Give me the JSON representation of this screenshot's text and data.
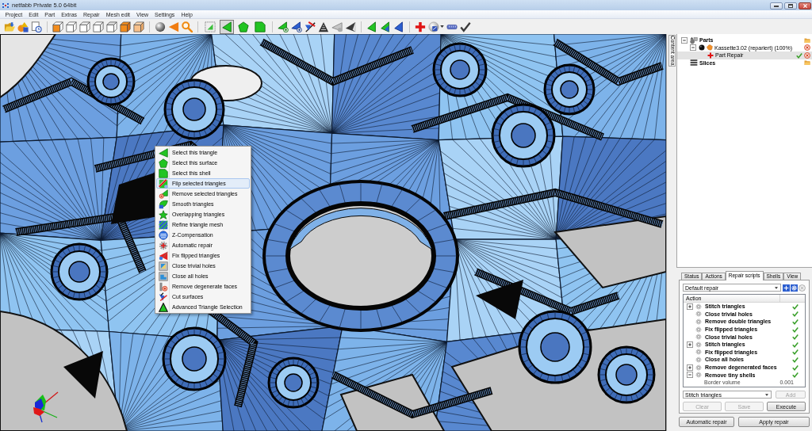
{
  "window": {
    "title": "netfabb Private 5.0 64bit"
  },
  "menu_bar": [
    "Project",
    "Edit",
    "Part",
    "Extras",
    "Repair",
    "Mesh edit",
    "View",
    "Settings",
    "Help"
  ],
  "toolbar": {
    "selection_tools": [
      {
        "selected": false
      },
      {
        "selected": true
      },
      {
        "selected": false
      },
      {
        "selected": false
      }
    ]
  },
  "context_menu": {
    "items": [
      {
        "label": "Select this triangle",
        "selected": false
      },
      {
        "label": "Select this surface",
        "selected": false
      },
      {
        "label": "Select this shell",
        "selected": false
      },
      {
        "label": "Flip selected triangles",
        "selected": true
      },
      {
        "label": "Remove selected triangles",
        "selected": false
      },
      {
        "label": "Smooth triangles",
        "selected": false
      },
      {
        "label": "Overlapping triangles",
        "selected": false
      },
      {
        "label": "Refine triangle mesh",
        "selected": false
      },
      {
        "label": "Z-Compensation",
        "selected": false
      },
      {
        "label": "Automatic repair",
        "selected": false
      },
      {
        "label": "Fix flipped triangles",
        "selected": false
      },
      {
        "label": "Close trivial holes",
        "selected": false
      },
      {
        "label": "Close all holes",
        "selected": false
      },
      {
        "label": "Remove degenerate faces",
        "selected": false
      },
      {
        "label": "Cut surfaces",
        "selected": false
      },
      {
        "label": "Advanced Triangle Selection",
        "selected": false
      }
    ]
  },
  "side_tab": {
    "label": "Content area"
  },
  "project_tree": [
    {
      "label": "Parts",
      "kind": "parts",
      "expanded": true,
      "selected": false,
      "children": [
        {
          "label": "Kassette3.02 (repariert) (100%)",
          "kind": "part",
          "expanded": true,
          "selected": false,
          "children": [
            {
              "label": "Part Repair",
              "kind": "repair",
              "expanded": false,
              "selected": true
            }
          ]
        }
      ]
    },
    {
      "label": "Slices",
      "kind": "slices",
      "expanded": false,
      "selected": false
    }
  ],
  "repair_panel": {
    "tabs": [
      {
        "label": "Status",
        "selected": false
      },
      {
        "label": "Actions",
        "selected": false
      },
      {
        "label": "Repair scripts",
        "selected": true
      },
      {
        "label": "Shells",
        "selected": false
      },
      {
        "label": "View",
        "selected": false
      }
    ],
    "script_select": {
      "value": "Default repair"
    },
    "script_tools": [
      {
        "disabled": false
      },
      {
        "disabled": false
      },
      {
        "disabled": true
      }
    ],
    "table": {
      "columns": [
        "Action"
      ],
      "rows": [
        {
          "label": "Stitch triangles",
          "expandable": true,
          "expanded": false,
          "done": true
        },
        {
          "label": "Close trivial holes",
          "expandable": false,
          "expanded": false,
          "done": true
        },
        {
          "label": "Remove double triangles",
          "expandable": false,
          "expanded": false,
          "done": true
        },
        {
          "label": "Fix flipped triangles",
          "expandable": false,
          "expanded": false,
          "done": true
        },
        {
          "label": "Close trivial holes",
          "expandable": false,
          "expanded": false,
          "done": true
        },
        {
          "label": "Stitch triangles",
          "expandable": true,
          "expanded": false,
          "done": true
        },
        {
          "label": "Fix flipped triangles",
          "expandable": false,
          "expanded": false,
          "done": true
        },
        {
          "label": "Close all holes",
          "expandable": false,
          "expanded": false,
          "done": true
        },
        {
          "label": "Remove degenerated faces",
          "expandable": true,
          "expanded": false,
          "done": true
        },
        {
          "label": "Remove tiny shells",
          "expandable": true,
          "expanded": true,
          "done": true,
          "children": [
            {
              "label": "Border volume",
              "value": "0.001"
            }
          ]
        }
      ]
    },
    "action_select": {
      "value": "Stitch triangles"
    },
    "add_button": {
      "label": "Add",
      "disabled": true
    },
    "script_buttons": [
      {
        "label": "Clear",
        "disabled": true
      },
      {
        "label": "Save",
        "disabled": true
      },
      {
        "label": "Execute",
        "disabled": false
      }
    ]
  },
  "footer_buttons": [
    {
      "label": "Automatic repair"
    },
    {
      "label": "Apply repair"
    }
  ]
}
